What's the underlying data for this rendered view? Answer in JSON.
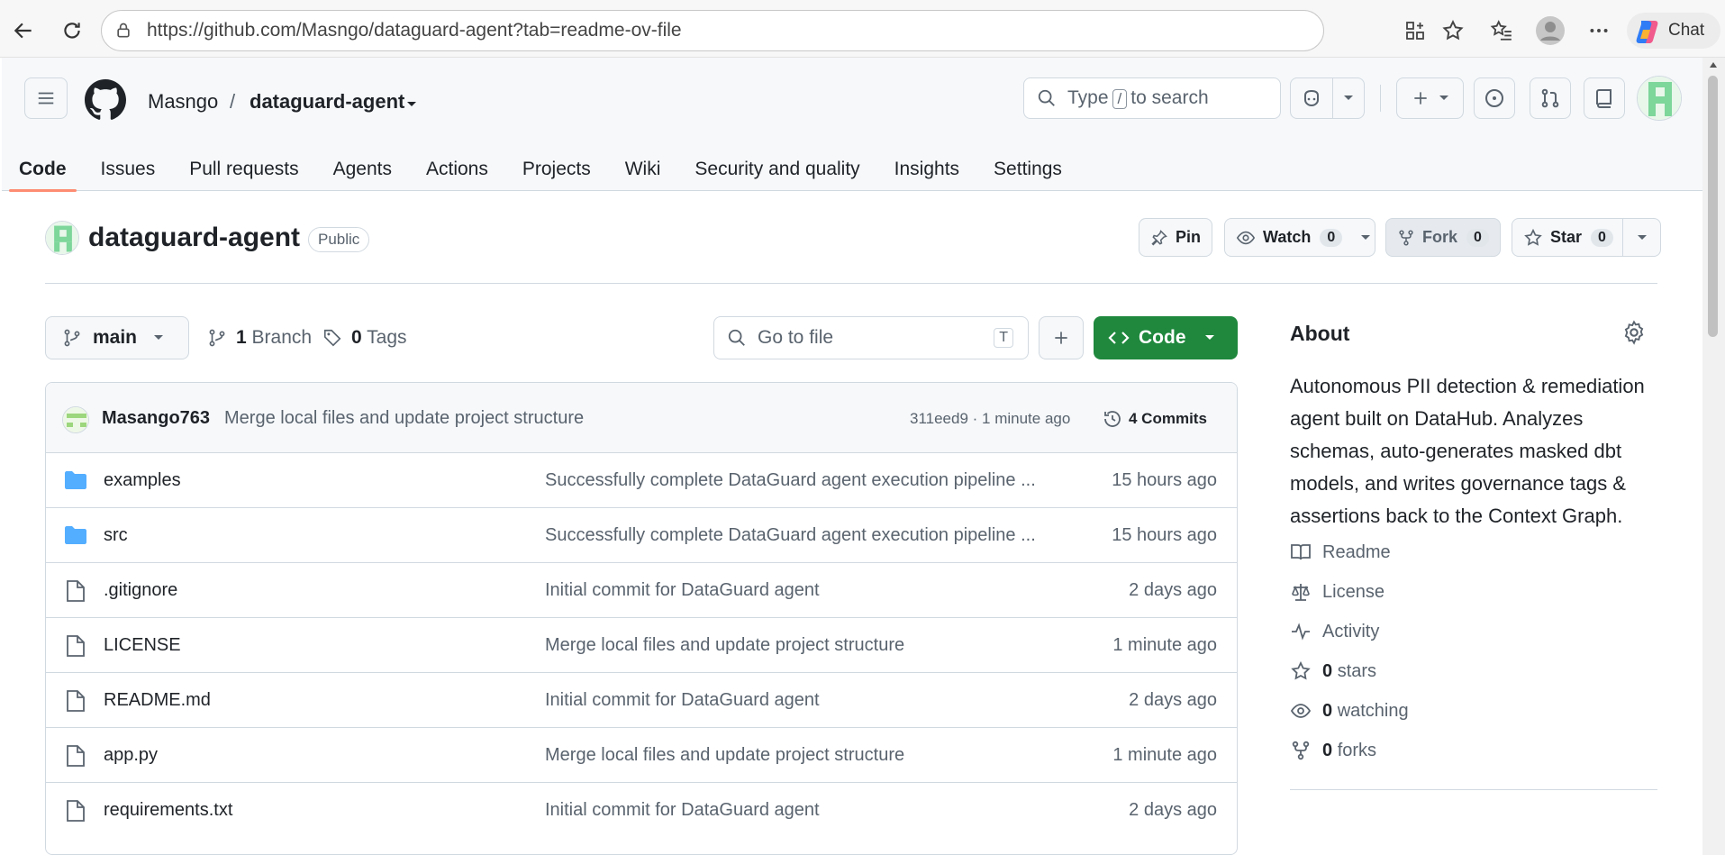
{
  "browser": {
    "url": "https://github.com/Masngo/dataguard-agent?tab=readme-ov-file",
    "chat_label": "Chat"
  },
  "header": {
    "owner": "Masngo",
    "separator": "/",
    "repo": "dataguard-agent",
    "search_prefix": "Type",
    "search_key": "/",
    "search_suffix": "to search"
  },
  "tabs": [
    {
      "label": "Code"
    },
    {
      "label": "Issues"
    },
    {
      "label": "Pull requests"
    },
    {
      "label": "Agents"
    },
    {
      "label": "Actions"
    },
    {
      "label": "Projects"
    },
    {
      "label": "Wiki"
    },
    {
      "label": "Security and quality"
    },
    {
      "label": "Insights"
    },
    {
      "label": "Settings"
    }
  ],
  "repo": {
    "title": "dataguard-agent",
    "visibility": "Public",
    "pin_label": "Pin",
    "watch_label": "Watch",
    "watch_count": "0",
    "fork_label": "Fork",
    "fork_count": "0",
    "star_label": "Star",
    "star_count": "0"
  },
  "toolbar": {
    "branch": "main",
    "branch_count": "1",
    "branch_label": "Branch",
    "tag_count": "0",
    "tag_label": "Tags",
    "goto_placeholder": "Go to file",
    "goto_key": "T",
    "code_label": "Code"
  },
  "commit": {
    "user": "Masango763",
    "message": "Merge local files and update project structure",
    "meta": "311eed9 · 1 minute ago",
    "commits_label": "4 Commits"
  },
  "files": [
    {
      "type": "folder",
      "name": "examples",
      "message": "Successfully complete DataGuard agent execution pipeline ...",
      "date": "15 hours ago"
    },
    {
      "type": "folder",
      "name": "src",
      "message": "Successfully complete DataGuard agent execution pipeline ...",
      "date": "15 hours ago"
    },
    {
      "type": "file",
      "name": ".gitignore",
      "message": "Initial commit for DataGuard agent",
      "date": "2 days ago"
    },
    {
      "type": "file",
      "name": "LICENSE",
      "message": "Merge local files and update project structure",
      "date": "1 minute ago"
    },
    {
      "type": "file",
      "name": "README.md",
      "message": "Initial commit for DataGuard agent",
      "date": "2 days ago"
    },
    {
      "type": "file",
      "name": "app.py",
      "message": "Merge local files and update project structure",
      "date": "1 minute ago"
    },
    {
      "type": "file",
      "name": "requirements.txt",
      "message": "Initial commit for DataGuard agent",
      "date": "2 days ago"
    }
  ],
  "about": {
    "heading": "About",
    "description": "Autonomous PII detection & remediation agent built on DataHub. Analyzes schemas, auto-generates masked dbt models, and writes governance tags & assertions back to the Context Graph.",
    "readme": "Readme",
    "license": "License",
    "activity": "Activity",
    "stars_count": "0",
    "stars_label": "stars",
    "watching_count": "0",
    "watching_label": "watching",
    "forks_count": "0",
    "forks_label": "forks"
  },
  "colors": {
    "accent_green": "#1f883d",
    "folder_blue": "#54aeff",
    "tab_underline": "#fd8c73"
  }
}
